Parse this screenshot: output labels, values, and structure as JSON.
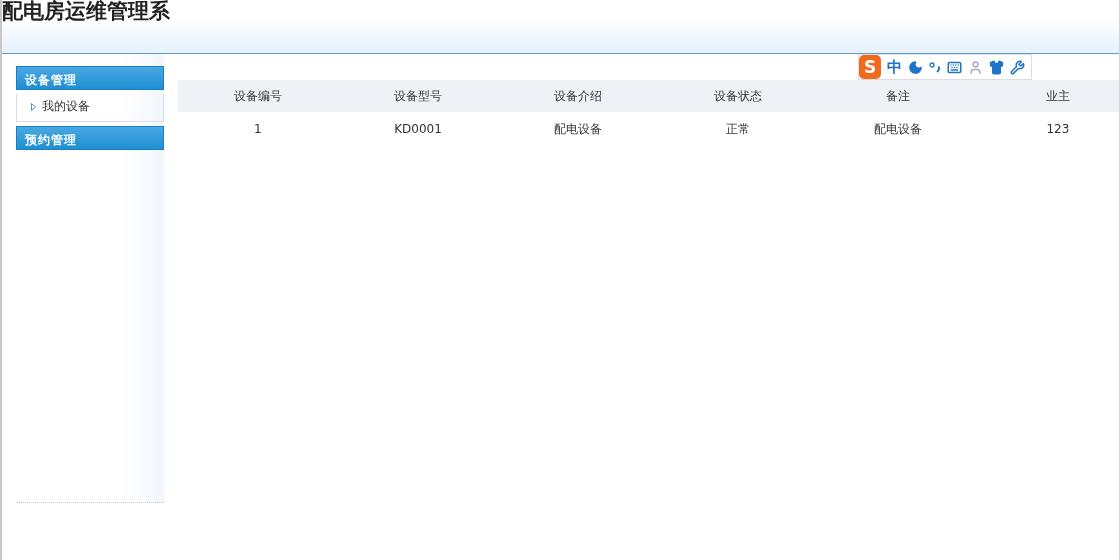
{
  "header": {
    "title": "配电房运维管理系"
  },
  "sidebar": {
    "groups": [
      {
        "label": "设备管理",
        "items": [
          {
            "label": "我的设备"
          }
        ]
      },
      {
        "label": "预约管理"
      }
    ]
  },
  "ime_toolbar": {
    "logo": "S",
    "mode": "中"
  },
  "table": {
    "columns": [
      "设备编号",
      "设备型号",
      "设备介绍",
      "设备状态",
      "备注",
      "业主"
    ],
    "rows": [
      [
        "1",
        "KD0001",
        "配电设备",
        "正常",
        "配电设备",
        "123"
      ]
    ]
  }
}
